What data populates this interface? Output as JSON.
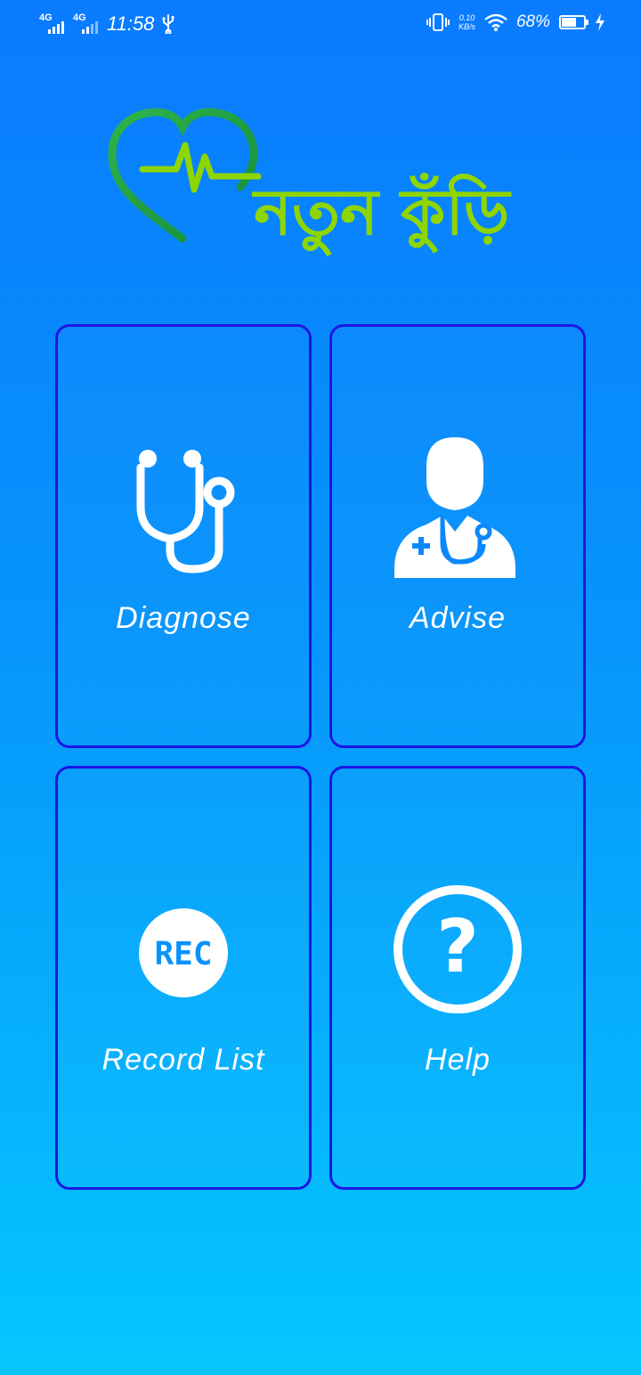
{
  "status_bar": {
    "network1": "4G",
    "network2": "4G",
    "time": "11:58",
    "speed_value": "0.10",
    "speed_unit": "KB/s",
    "battery": "68%",
    "battery_level": 0.68
  },
  "logo": {
    "text": "নতুন কুঁড়ি",
    "heart_color": "#21a84c",
    "text_color": "#8fd600"
  },
  "tiles": [
    {
      "label": "Diagnose",
      "icon": "stethoscope-icon"
    },
    {
      "label": "Advise",
      "icon": "doctor-icon"
    },
    {
      "label": "Record List",
      "icon": "rec-icon",
      "icon_text": "REC"
    },
    {
      "label": "Help",
      "icon": "help-icon",
      "icon_text": "?"
    }
  ],
  "colors": {
    "background_top": "#0a7bff",
    "background_bottom": "#05c6ff",
    "tile_border": "#1d16e6"
  }
}
